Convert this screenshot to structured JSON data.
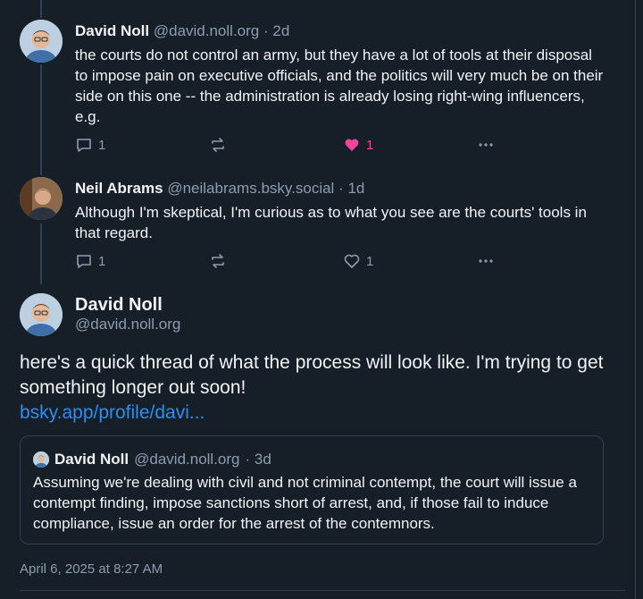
{
  "posts": [
    {
      "author": "David Noll",
      "handle": "@david.noll.org",
      "time": "· 2d",
      "text": "the courts do not control an army, but they have a lot of tools at their disposal to impose pain on executive officials, and the politics will very much be on their side on this one -- the administration is already losing right-wing influencers, e.g.",
      "replies": "1",
      "likes": "1",
      "liked": true
    },
    {
      "author": "Neil Abrams",
      "handle": "@neilabrams.bsky.social",
      "time": "· 1d",
      "text": "Although I'm skeptical, I'm curious as to what you see are the courts' tools in that regard.",
      "replies": "1",
      "likes": "1",
      "liked": false
    }
  ],
  "main": {
    "author": "David Noll",
    "handle": "@david.noll.org",
    "text": "here's a quick thread of what the process will look like. I'm trying to get something longer out soon!",
    "link": "bsky.app/profile/davi...",
    "timestamp": "April 6, 2025 at 8:27 AM"
  },
  "quote": {
    "author": "David Noll",
    "handle": "@david.noll.org",
    "time": "· 3d",
    "text": "Assuming we're dealing with civil and not criminal contempt, the court will issue a contempt finding, impose sanctions short of arrest, and, if those fail to induce compliance, issue an order for the arrest of the contemnors."
  },
  "icons": {
    "reply": "reply-icon",
    "repost": "repost-icon",
    "like": "heart-icon",
    "more": "more-icon"
  },
  "colors": {
    "background": "#161e27",
    "muted": "#8c9db0",
    "like": "#ec4899",
    "link": "#2f8cf0"
  }
}
